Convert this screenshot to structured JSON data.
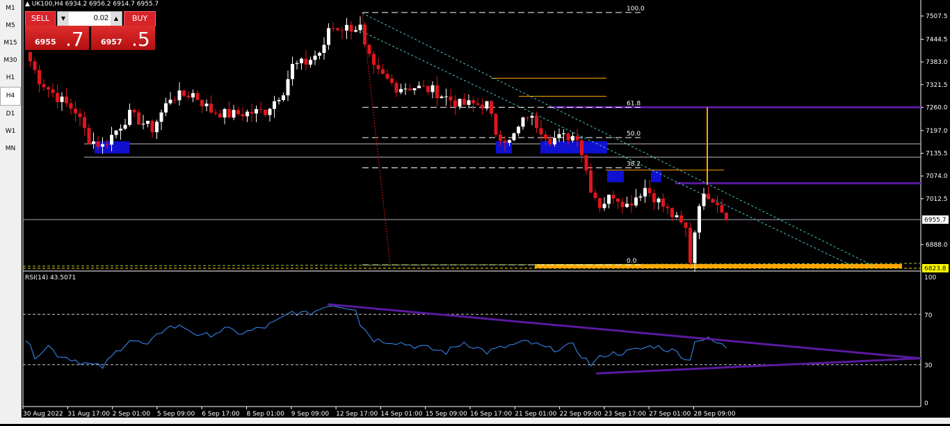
{
  "timeframes": [
    "M1",
    "M5",
    "M15",
    "M30",
    "H1",
    "H4",
    "D1",
    "W1",
    "MN"
  ],
  "active_timeframe": "H4",
  "header": {
    "symbol_line": "UK100,H4  6934.2 6956.2 6914.7 6955.7"
  },
  "trade_panel": {
    "sell_label": "SELL",
    "buy_label": "BUY",
    "lot_value": "0.02",
    "sell_big": "6955",
    "sell_frac": ".7",
    "buy_big": "6957",
    "buy_frac": ".5"
  },
  "price_axis": {
    "ticks": [
      "7507.5",
      "7444.5",
      "7383.0",
      "7321.5",
      "7260.0",
      "7197.0",
      "7135.5",
      "7074.0",
      "7012.5",
      "6888.0"
    ],
    "current_price": "6955.7",
    "marker_price": "6823.8"
  },
  "fibonacci": {
    "levels": [
      "100.0",
      "61.8",
      "50.0",
      "38.2",
      "0.0"
    ]
  },
  "rsi": {
    "label": "RSI(14) 43.5071",
    "ticks": [
      "100",
      "70",
      "30",
      "0"
    ]
  },
  "time_axis": [
    "30 Aug 2022",
    "31 Aug 17:00",
    "2 Sep 01:00",
    "5 Sep 09:00",
    "6 Sep 17:00",
    "8 Sep 01:00",
    "9 Sep 09:00",
    "12 Sep 17:00",
    "14 Sep 01:00",
    "15 Sep 09:00",
    "16 Sep 17:00",
    "21 Sep 01:00",
    "22 Sep 09:00",
    "23 Sep 17:00",
    "27 Sep 01:00",
    "28 Sep 09:00"
  ],
  "chart_data": {
    "type": "candlestick",
    "price_range": [
      6810,
      7530
    ],
    "close_keypoints": [
      [
        0,
        7410
      ],
      [
        3,
        7334
      ],
      [
        7,
        7287
      ],
      [
        11,
        7250
      ],
      [
        14,
        7174
      ],
      [
        17,
        7155
      ],
      [
        23,
        7240
      ],
      [
        28,
        7202
      ],
      [
        32,
        7287
      ],
      [
        37,
        7297
      ],
      [
        41,
        7250
      ],
      [
        45,
        7240
      ],
      [
        53,
        7250
      ],
      [
        57,
        7306
      ],
      [
        59,
        7372
      ],
      [
        62,
        7381
      ],
      [
        66,
        7419
      ],
      [
        67,
        7476
      ],
      [
        74,
        7476
      ],
      [
        75,
        7419
      ],
      [
        77,
        7362
      ],
      [
        82,
        7315
      ],
      [
        86,
        7315
      ],
      [
        90,
        7306
      ],
      [
        96,
        7268
      ],
      [
        102,
        7268
      ],
      [
        104,
        7193
      ],
      [
        107,
        7165
      ],
      [
        111,
        7240
      ],
      [
        116,
        7174
      ],
      [
        122,
        7184
      ],
      [
        125,
        7042
      ],
      [
        127,
        6995
      ],
      [
        130,
        7024
      ],
      [
        133,
        6995
      ],
      [
        137,
        7042
      ],
      [
        140,
        7005
      ],
      [
        143,
        6967
      ],
      [
        146,
        6929
      ],
      [
        147,
        6845
      ],
      [
        149,
        7005
      ],
      [
        151,
        7024
      ],
      [
        153,
        7005
      ],
      [
        155,
        6956
      ]
    ],
    "rsi_keypoints": [
      [
        0,
        50
      ],
      [
        2,
        37
      ],
      [
        5,
        45
      ],
      [
        7,
        38
      ],
      [
        10,
        35
      ],
      [
        14,
        30
      ],
      [
        17,
        28
      ],
      [
        20,
        40
      ],
      [
        23,
        50
      ],
      [
        27,
        45
      ],
      [
        31,
        60
      ],
      [
        35,
        60
      ],
      [
        39,
        52
      ],
      [
        44,
        58
      ],
      [
        48,
        55
      ],
      [
        53,
        60
      ],
      [
        56,
        65
      ],
      [
        59,
        72
      ],
      [
        62,
        70
      ],
      [
        65,
        74
      ],
      [
        67,
        78
      ],
      [
        73,
        75
      ],
      [
        74,
        62
      ],
      [
        77,
        50
      ],
      [
        82,
        48
      ],
      [
        86,
        45
      ],
      [
        93,
        40
      ],
      [
        97,
        48
      ],
      [
        102,
        40
      ],
      [
        107,
        45
      ],
      [
        111,
        48
      ],
      [
        116,
        42
      ],
      [
        121,
        45
      ],
      [
        125,
        30
      ],
      [
        128,
        38
      ],
      [
        133,
        40
      ],
      [
        139,
        45
      ],
      [
        144,
        40
      ],
      [
        147,
        33
      ],
      [
        148,
        50
      ],
      [
        151,
        50
      ],
      [
        155,
        44
      ]
    ]
  },
  "colors": {
    "bull": "#ffffff",
    "bear": "#e0161b",
    "rsi": "#3d8fff",
    "trend": "#5a1a9e",
    "fib": "#ffffff",
    "orange": "#ffa500",
    "zone": "#1010d0"
  }
}
